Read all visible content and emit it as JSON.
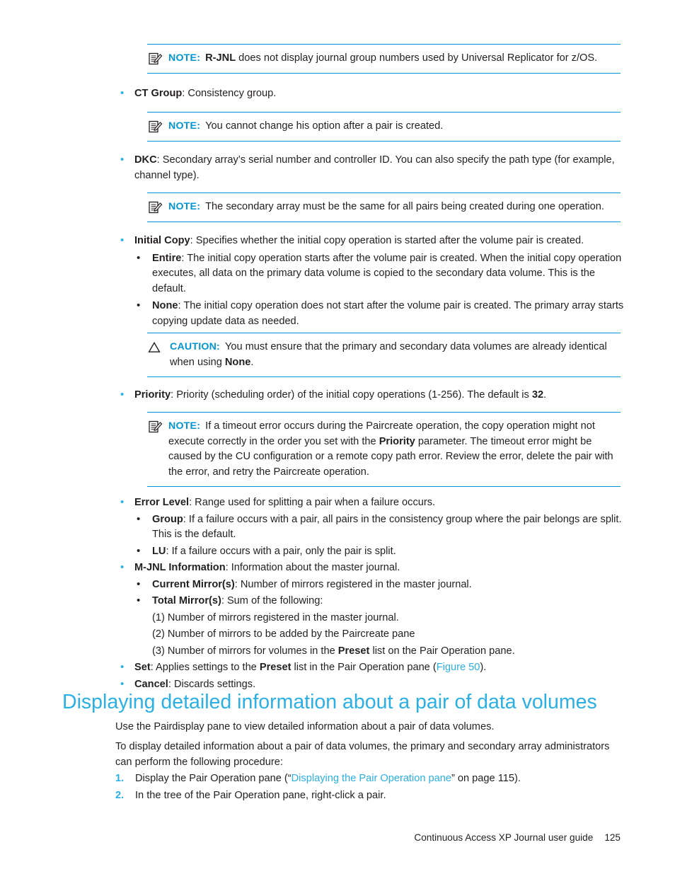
{
  "document": {
    "footer": {
      "guide_title": "Continuous Access XP Journal user guide",
      "page_number": "125"
    },
    "colors": {
      "accent_blue": "#0096D6",
      "link_blue": "#2AB0E4",
      "text": "#231F20"
    }
  },
  "blocks": {
    "note1": {
      "label": "NOTE:",
      "icon": "note-icon",
      "text_bold_lead": "R-JNL",
      "text": " does not display journal group numbers used by Universal Replicator for z/OS."
    },
    "bullet_ct_group": {
      "term": "CT Group",
      "text": ": Consistency group."
    },
    "note2": {
      "label": "NOTE:",
      "icon": "note-icon",
      "text": "You cannot change his option after a pair is created."
    },
    "bullet_dkc": {
      "term": "DKC",
      "text": ": Secondary array’s serial number and controller ID. You can also specify the path type (for example, channel type)."
    },
    "note3": {
      "label": "NOTE:",
      "icon": "note-icon",
      "text": "The secondary array must be the same for all pairs being created during one operation."
    },
    "bullet_initial_copy": {
      "term": "Initial Copy",
      "text": ": Specifies whether the initial copy operation is started after the volume pair is created."
    },
    "bullet_entire": {
      "term": "Entire",
      "text": ": The initial copy operation starts after the volume pair is created. When the initial copy operation executes, all data on the primary data volume is copied to the secondary data volume. This is the default."
    },
    "bullet_none": {
      "term": "None",
      "text": ": The initial copy operation does not start after the volume pair is created. The primary array starts copying update data as needed."
    },
    "caution1": {
      "label": "CAUTION:",
      "icon": "caution-triangle-icon",
      "text_part1": "You must ensure that the primary and secondary data volumes are already identical when using ",
      "text_bold": "None",
      "text_part2": "."
    },
    "bullet_priority": {
      "term": "Priority",
      "text_part1": ": Priority (scheduling order) of the initial copy operations (1-256). The default is ",
      "text_bold": "32",
      "text_part2": "."
    },
    "note4": {
      "label": "NOTE:",
      "icon": "note-icon",
      "text_part1": "If a timeout error occurs during the Paircreate operation, the copy operation might not execute correctly in the order you set with the ",
      "text_bold": "Priority",
      "text_part2": " parameter. The timeout error might be caused by the CU configuration or a remote copy path error. Review the error, delete the pair with the error, and retry the Paircreate operation."
    },
    "bullet_error_level": {
      "term": "Error Level",
      "text": ": Range used for splitting a pair when a failure occurs."
    },
    "bullet_group": {
      "term": "Group",
      "text": ": If a failure occurs with a pair, all pairs in the consistency group where the pair belongs are split. This is the default."
    },
    "bullet_lu": {
      "term": "LU",
      "text": ": If a failure occurs with a pair, only the pair is split."
    },
    "bullet_mjnl": {
      "term": "M-JNL Information",
      "text": ": Information about the master journal."
    },
    "bullet_current_mirrors": {
      "term": "Current Mirror(s)",
      "text": ": Number of mirrors registered in the master journal."
    },
    "bullet_total_mirrors": {
      "term": "Total Mirror(s)",
      "text": ": Sum of the following:"
    },
    "total_mirrors_items": [
      {
        "text": "(1) Number of mirrors registered in the master journal."
      },
      {
        "text": "(2) Number of mirrors to be added by the Paircreate pane"
      },
      {
        "text_part1": "(3) Number of mirrors for volumes in the ",
        "text_bold": "Preset",
        "text_part2": " list on the Pair Operation pane."
      }
    ],
    "bullet_set": {
      "term": "Set",
      "text_part1": ": Applies settings to the ",
      "text_bold": "Preset",
      "text_part2": " list in the Pair Operation pane (",
      "link": "Figure 50",
      "text_part3": ")."
    },
    "bullet_cancel": {
      "term": "Cancel",
      "text": ": Discards settings."
    }
  },
  "section": {
    "title": "Displaying detailed information about a pair of data volumes",
    "para1": "Use the Pairdisplay pane to view detailed information about a pair of data volumes.",
    "para2": "To display detailed information about a pair of data volumes, the primary and secondary array administrators can perform the following procedure:",
    "steps": [
      {
        "num": "1.",
        "text_part1": "Display the Pair Operation pane (“",
        "link": "Displaying the Pair Operation pane",
        "text_part2": "” on page 115)."
      },
      {
        "num": "2.",
        "text": "In the tree of the Pair Operation pane, right-click a pair."
      }
    ]
  }
}
